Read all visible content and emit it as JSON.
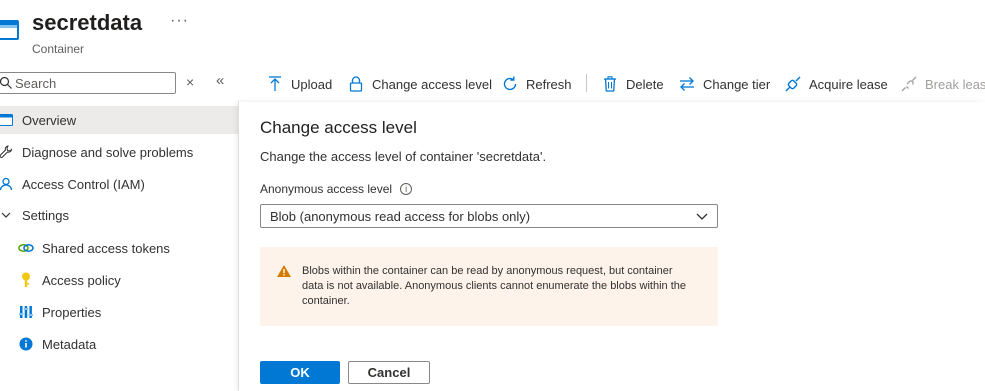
{
  "header": {
    "title": "secretdata",
    "subtitle": "Container",
    "more": "···"
  },
  "sidebar": {
    "search_placeholder": "Search",
    "clear": "×",
    "collapse": "«",
    "items": [
      {
        "label": "Overview",
        "icon": "container-icon"
      },
      {
        "label": "Diagnose and solve problems",
        "icon": "wrench-icon"
      },
      {
        "label": "Access Control (IAM)",
        "icon": "people-icon"
      },
      {
        "label": "Settings",
        "icon": "chevron-down-icon"
      },
      {
        "label": "Shared access tokens",
        "icon": "link-icon"
      },
      {
        "label": "Access policy",
        "icon": "key-icon"
      },
      {
        "label": "Properties",
        "icon": "properties-icon"
      },
      {
        "label": "Metadata",
        "icon": "info-icon"
      }
    ]
  },
  "toolbar": {
    "upload": "Upload",
    "change_access_level": "Change access level",
    "refresh": "Refresh",
    "delete": "Delete",
    "change_tier": "Change tier",
    "acquire_lease": "Acquire lease",
    "break_lease": "Break lease"
  },
  "panel": {
    "title": "Change access level",
    "description": "Change the access level of container 'secretdata'.",
    "field_label": "Anonymous access level",
    "info": "i",
    "selected_value": "Blob (anonymous read access for blobs only)",
    "warning": "Blobs within the container can be read by anonymous request, but container data is not available. Anonymous clients cannot enumerate the blobs within the container.",
    "ok": "OK",
    "cancel": "Cancel"
  },
  "colors": {
    "accent": "#0078d4",
    "warning_bg": "#fdf3ea",
    "warning_icon": "#d47a00"
  }
}
